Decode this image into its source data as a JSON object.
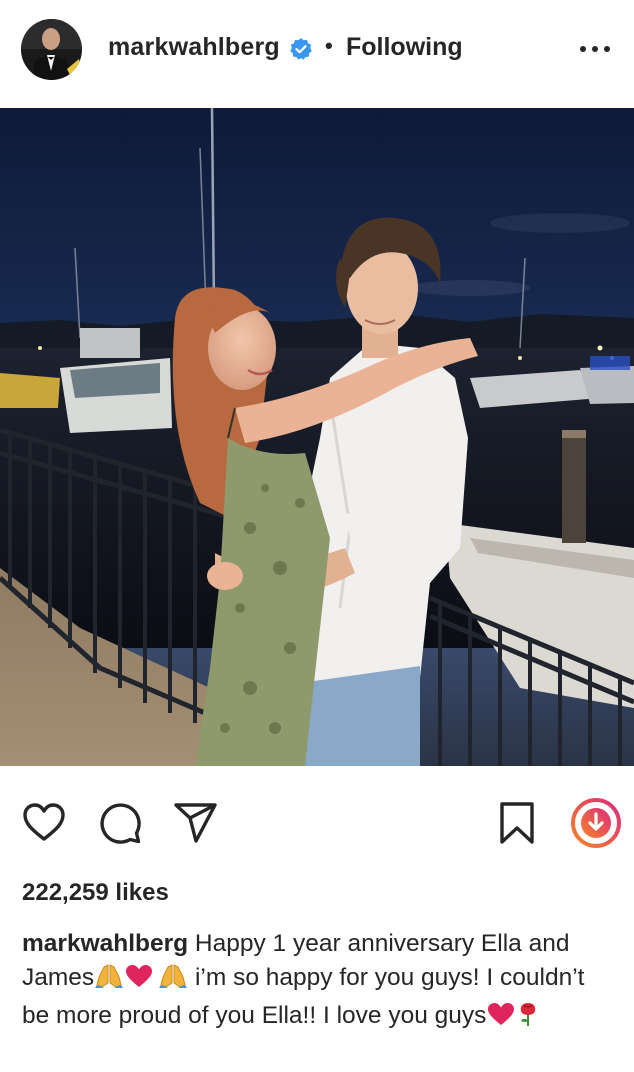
{
  "post": {
    "username": "markwahlberg",
    "separator": "•",
    "follow_status": "Following",
    "likes": "222,259 likes",
    "caption": {
      "username": "markwahlberg",
      "part1": " Happy 1 year anniversary Ella and James",
      "part2": " i’m so happy for you guys! I couldn’t be more proud of you Ella!! I love you guys",
      "emojis": [
        "folded-hands",
        "red-heart",
        "folded-hands",
        "red-heart",
        "rose"
      ]
    }
  },
  "icons": {
    "verified": "verified-badge-icon",
    "more": "more-options-icon",
    "like": "heart-icon",
    "comment": "comment-icon",
    "share": "paper-plane-icon",
    "save": "bookmark-icon",
    "download": "download-icon"
  },
  "colors": {
    "text": "#262626",
    "verified_blue": "#3897f0",
    "heart_red": "#e0245e",
    "download_gradient_start": "#f58529",
    "download_gradient_end": "#dd2a7b"
  }
}
